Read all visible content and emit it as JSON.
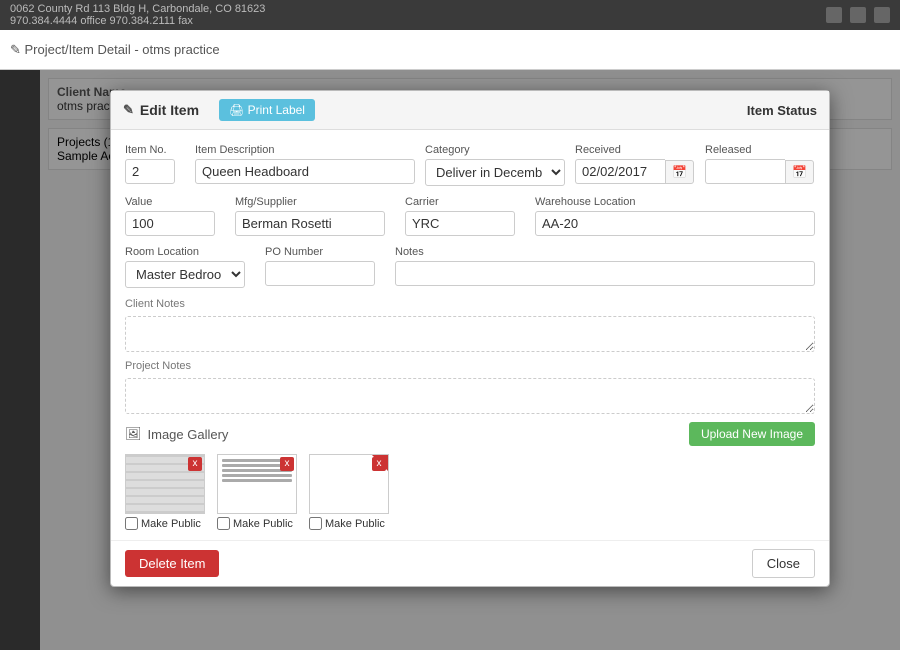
{
  "topbar": {
    "address": "0062 County Rd 113 Bldg H, Carbondale, CO 81623",
    "phone": "970.384.4444 office 970.384.2111 fax"
  },
  "app_header": {
    "project_detail_label": "✎ Project/Item Detail - otms practice"
  },
  "background": {
    "client_label": "Client Name",
    "client_value": "otms practice",
    "projects_label": "Projects (1)",
    "project_name": "Sample Accou..."
  },
  "modal": {
    "title": "Edit Item",
    "item_status_label": "Item Status",
    "print_label_btn": "🖨 Print Label",
    "form": {
      "item_no_label": "Item No.",
      "item_no_value": "2",
      "item_description_label": "Item Description",
      "item_description_value": "Queen Headboard",
      "category_label": "Category",
      "category_value": "Deliver in December",
      "received_label": "Received",
      "received_value": "02/02/2017",
      "released_label": "Released",
      "released_value": "",
      "value_label": "Value",
      "value_value": "100",
      "mfg_supplier_label": "Mfg/Supplier",
      "mfg_supplier_value": "Berman Rosetti",
      "carrier_label": "Carrier",
      "carrier_value": "YRC",
      "warehouse_location_label": "Warehouse Location",
      "warehouse_location_value": "AA-20",
      "room_location_label": "Room Location",
      "room_location_value": "Master Bedroom",
      "po_number_label": "PO Number",
      "po_number_value": "",
      "notes_label": "Notes",
      "notes_value": "",
      "client_notes_label": "Client Notes",
      "client_notes_value": "",
      "project_notes_label": "Project Notes",
      "project_notes_value": ""
    },
    "image_gallery": {
      "title": "Image Gallery",
      "upload_btn": "Upload New Image",
      "images": [
        {
          "id": 1,
          "alt": "Headboard image 1",
          "type": "lines",
          "make_public": false
        },
        {
          "id": 2,
          "alt": "Document image 2",
          "type": "doc",
          "make_public": false
        },
        {
          "id": 3,
          "alt": "Document image 3",
          "type": "redcorner",
          "make_public": false
        }
      ],
      "make_public_label": "Make Public",
      "delete_symbol": "x"
    },
    "footer": {
      "delete_btn": "Delete Item",
      "close_btn": "Close"
    }
  }
}
